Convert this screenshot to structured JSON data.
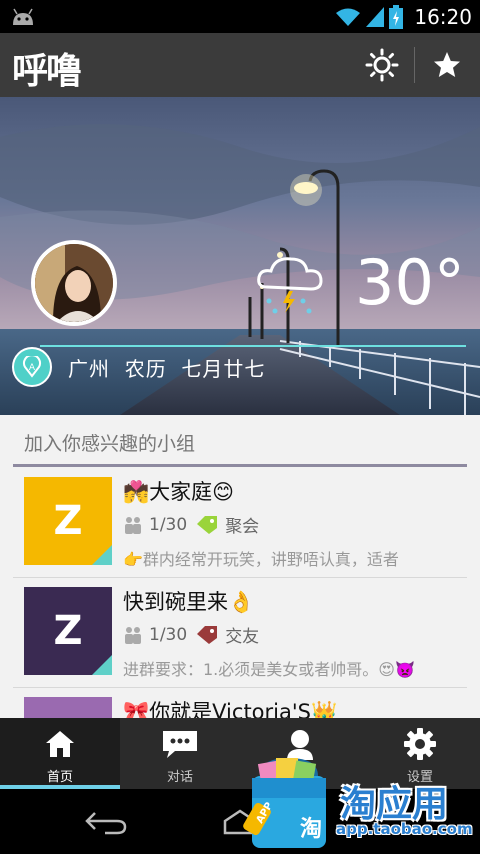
{
  "status_bar": {
    "time": "16:20"
  },
  "action_bar": {
    "title": "呼噜"
  },
  "weather": {
    "temperature": "30°",
    "location": "广州  农历  七月廿七"
  },
  "groups_section": {
    "title": "加入你感兴趣的小组",
    "groups": [
      {
        "name": "大家庭",
        "members": "1/30",
        "tag": "聚会",
        "description": "群内经常开玩笑，讲野唔认真，适者",
        "thumb_color": "#f5b800",
        "tag_color": "#9ad43a"
      },
      {
        "name": "快到碗里来",
        "members": "1/30",
        "tag": "交友",
        "description": "进群要求：1.必须是美女或者帅哥。",
        "thumb_color": "#3a2a52",
        "tag_color": "#9a3a3a"
      },
      {
        "name": "你就是Victoria'S",
        "thumb_color": "#9a6ab0"
      }
    ]
  },
  "tabs": [
    {
      "label": "首页",
      "icon": "home-icon"
    },
    {
      "label": "对话",
      "icon": "chat-icon"
    },
    {
      "label": "",
      "icon": "profile-icon"
    },
    {
      "label": "设置",
      "icon": "gear-icon"
    }
  ],
  "watermark": {
    "brand": "淘应用",
    "url": "app.taobao.com",
    "badge": "APP",
    "bag_char": "淘"
  },
  "colors": {
    "accent": "#6ed0e8",
    "actionbar": "#3b3b3b",
    "tabbar": "#2b2b2b"
  }
}
